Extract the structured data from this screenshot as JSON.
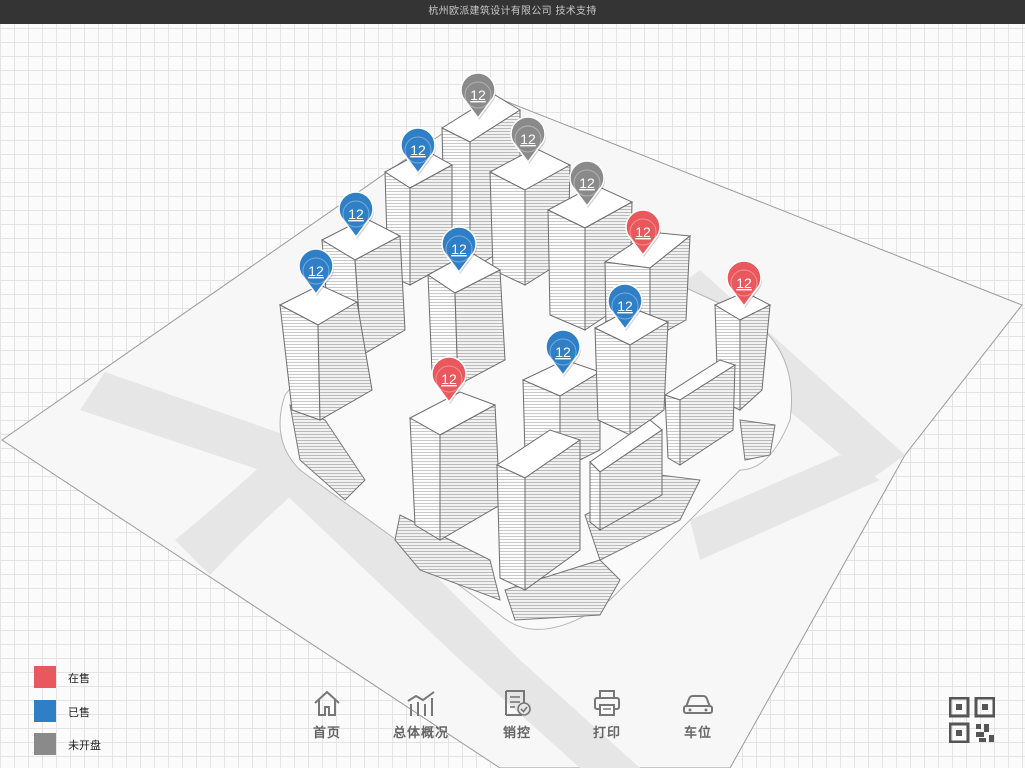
{
  "header": {
    "credit": "杭州欧派建筑设计有限公司   技术支持"
  },
  "colors": {
    "on_sale": "#e8585c",
    "sold": "#2f7fc6",
    "not_released": "#8a8a8a"
  },
  "legend": [
    {
      "label": "在售",
      "status": "on_sale",
      "color": "#e8585c"
    },
    {
      "label": "已售",
      "status": "sold",
      "color": "#2f7fc6"
    },
    {
      "label": "未开盘",
      "status": "not_released",
      "color": "#8a8a8a"
    }
  ],
  "markers": [
    {
      "label": "12",
      "status": "not_released"
    },
    {
      "label": "12",
      "status": "not_released"
    },
    {
      "label": "12",
      "status": "sold"
    },
    {
      "label": "12",
      "status": "not_released"
    },
    {
      "label": "12",
      "status": "sold"
    },
    {
      "label": "12",
      "status": "sold"
    },
    {
      "label": "12",
      "status": "on_sale"
    },
    {
      "label": "12",
      "status": "sold"
    },
    {
      "label": "12",
      "status": "on_sale"
    },
    {
      "label": "12",
      "status": "sold"
    },
    {
      "label": "12",
      "status": "sold"
    },
    {
      "label": "12",
      "status": "on_sale"
    }
  ],
  "nav": [
    {
      "label": "首页",
      "icon": "home-icon"
    },
    {
      "label": "总体概况",
      "icon": "bar-chart-icon"
    },
    {
      "label": "销控",
      "icon": "checklist-icon"
    },
    {
      "label": "打印",
      "icon": "printer-icon"
    },
    {
      "label": "车位",
      "icon": "car-icon"
    }
  ],
  "qr": {
    "icon": "qr-code-icon"
  }
}
